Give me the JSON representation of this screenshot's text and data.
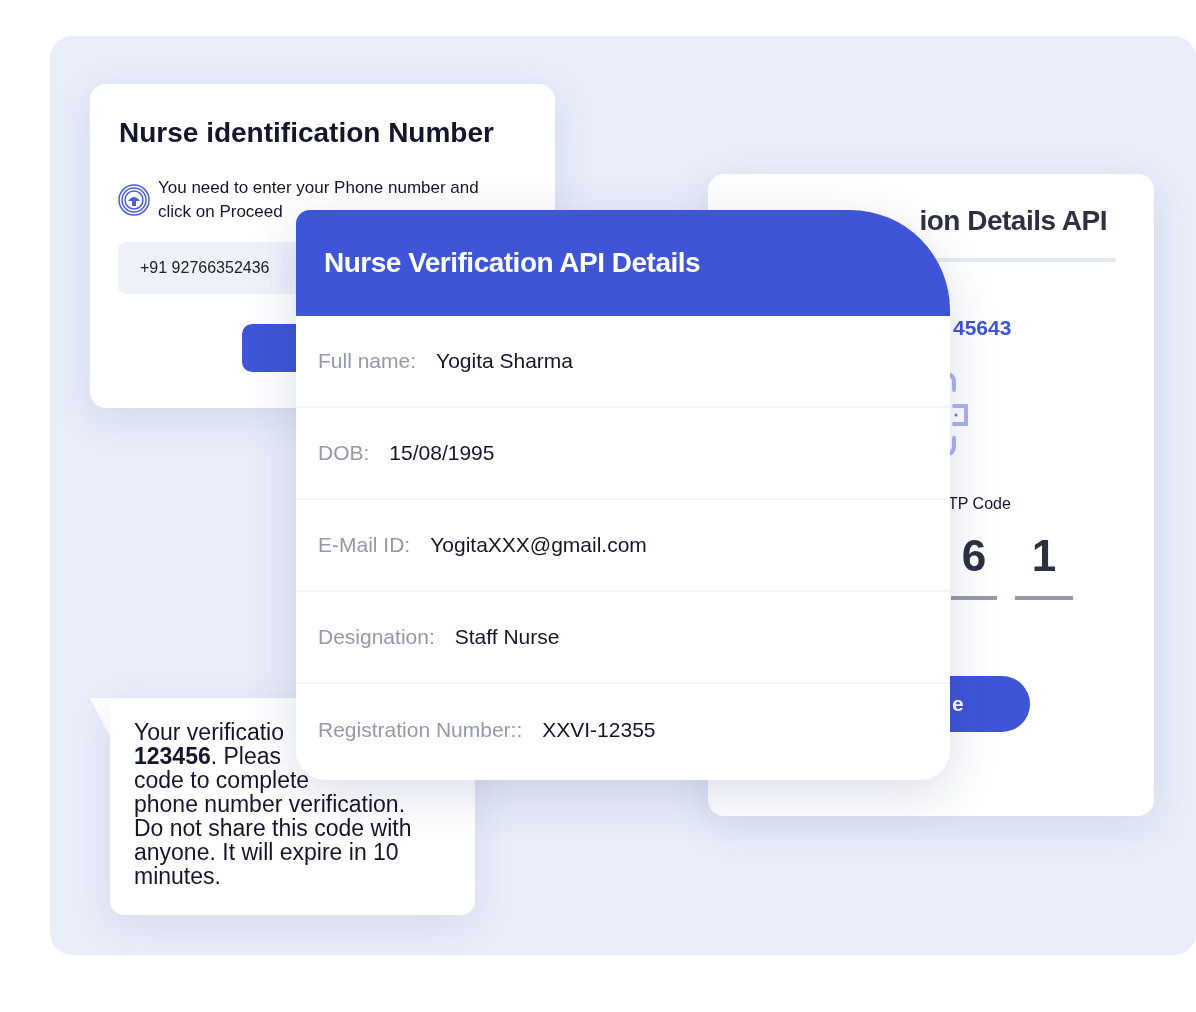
{
  "id_card": {
    "title": "Nurse identification Number",
    "description_lines": [
      "You need to enter your Phone number and",
      "click on Proceed"
    ],
    "phone_value": "+91 92766352436"
  },
  "details_api_card": {
    "title": "ion Details API",
    "number": "45643",
    "otp_label": "TP Code",
    "otp_digits": [
      "6",
      "1"
    ],
    "button_label": "e"
  },
  "verification_card": {
    "title": "Nurse Verification API Details",
    "fields": [
      {
        "label": "Full name:",
        "value": "Yogita Sharma"
      },
      {
        "label": "DOB:",
        "value": "15/08/1995"
      },
      {
        "label": "E-Mail ID:",
        "value": "YogitaXXX@gmail.com"
      },
      {
        "label": "Designation:",
        "value": "Staff Nurse"
      },
      {
        "label": "Registration Number::",
        "value": "XXVI-12355"
      }
    ]
  },
  "sms_message": {
    "lines": [
      "Your verificatio",
      "**123456**. Pleas",
      "code to complete",
      "phone number verification.",
      "Do not share this code with",
      "anyone. It will expire in 10",
      "minutes."
    ]
  }
}
